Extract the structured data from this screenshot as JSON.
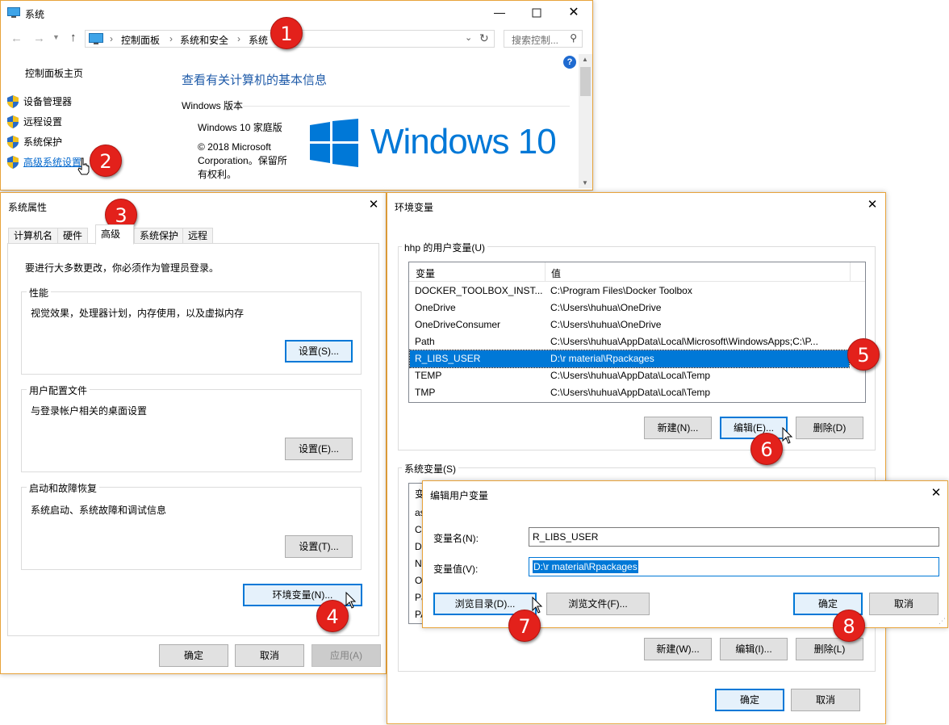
{
  "system_window": {
    "title": "系统",
    "address_parts": [
      "控制面板",
      "系统和安全",
      "系统"
    ],
    "search_placeholder": "搜索控制...",
    "sidebar_home": "控制面板主页",
    "sidebar_items": [
      "设备管理器",
      "远程设置",
      "系统保护",
      "高级系统设置"
    ],
    "heading": "查看有关计算机的基本信息",
    "section_label": "Windows 版本",
    "edition": "Windows 10 家庭版",
    "copyright": "© 2018 Microsoft Corporation。保留所有权利。",
    "logo_text": "Windows 10",
    "help_glyph": "?"
  },
  "sys_props": {
    "title": "系统属性",
    "tabs": [
      "计算机名",
      "硬件",
      "高级",
      "系统保护",
      "远程"
    ],
    "active_tab": "高级",
    "admin_note": "要进行大多数更改，你必须作为管理员登录。",
    "perf_label": "性能",
    "perf_desc": "视觉效果，处理器计划，内存使用，以及虚拟内存",
    "perf_button": "设置(S)...",
    "profile_label": "用户配置文件",
    "profile_desc": "与登录帐户相关的桌面设置",
    "profile_button": "设置(E)...",
    "startup_label": "启动和故障恢复",
    "startup_desc": "系统启动、系统故障和调试信息",
    "startup_button": "设置(T)...",
    "env_button": "环境变量(N)...",
    "ok": "确定",
    "cancel": "取消",
    "apply": "应用(A)"
  },
  "env_vars": {
    "title": "环境变量",
    "user_group": "hhp 的用户变量(U)",
    "col_var": "变量",
    "col_val": "值",
    "user_rows": [
      {
        "name": "DOCKER_TOOLBOX_INST...",
        "value": "C:\\Program Files\\Docker Toolbox"
      },
      {
        "name": "OneDrive",
        "value": "C:\\Users\\huhua\\OneDrive"
      },
      {
        "name": "OneDriveConsumer",
        "value": "C:\\Users\\huhua\\OneDrive"
      },
      {
        "name": "Path",
        "value": "C:\\Users\\huhua\\AppData\\Local\\Microsoft\\WindowsApps;C:\\P..."
      },
      {
        "name": "R_LIBS_USER",
        "value": "D:\\r material\\Rpackages"
      },
      {
        "name": "TEMP",
        "value": "C:\\Users\\huhua\\AppData\\Local\\Temp"
      },
      {
        "name": "TMP",
        "value": "C:\\Users\\huhua\\AppData\\Local\\Temp"
      }
    ],
    "selected_row": "R_LIBS_USER",
    "user_new": "新建(N)...",
    "user_edit": "编辑(E)...",
    "user_delete": "删除(D)",
    "sys_group": "系统变量(S)",
    "sys_col_var": "变",
    "sys_rows_partial": [
      "as",
      "Co",
      "D",
      "N",
      "O",
      "Pa",
      "PA"
    ],
    "sys_new": "新建(W)...",
    "sys_edit": "编辑(I)...",
    "sys_delete": "删除(L)",
    "ok": "确定",
    "cancel": "取消"
  },
  "edit_dialog": {
    "title": "编辑用户变量",
    "name_label": "变量名(N):",
    "name_value": "R_LIBS_USER",
    "value_label": "变量值(V):",
    "value_value": "D:\\r material\\Rpackages",
    "browse_dir": "浏览目录(D)...",
    "browse_file": "浏览文件(F)...",
    "ok": "确定",
    "cancel": "取消"
  },
  "step_badges": [
    "1",
    "2",
    "3",
    "4",
    "5",
    "6",
    "7",
    "8"
  ],
  "colors": {
    "accent": "#0078d7",
    "badge": "#e3211b",
    "window_border": "#e8a33a",
    "link": "#0066cc",
    "heading": "#1e5aa8"
  }
}
